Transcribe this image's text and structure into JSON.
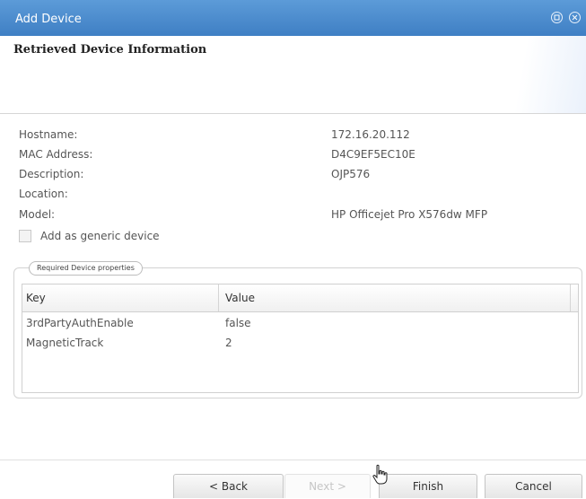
{
  "titlebar": {
    "title": "Add Device"
  },
  "header": {
    "title": "Retrieved Device Information"
  },
  "fields": [
    {
      "label": "Hostname:",
      "value": "172.16.20.112"
    },
    {
      "label": "MAC Address:",
      "value": "D4C9EF5EC10E"
    },
    {
      "label": "Description:",
      "value": "OJP576"
    },
    {
      "label": "Location:",
      "value": ""
    },
    {
      "label": "Model:",
      "value": "HP Officejet Pro X576dw MFP"
    }
  ],
  "generic_device": {
    "label": "Add as generic device",
    "checked": false
  },
  "properties": {
    "legend": "Required Device properties",
    "columns": [
      "Key",
      "Value"
    ],
    "rows": [
      {
        "key": "3rdPartyAuthEnable",
        "value": "false"
      },
      {
        "key": "MagneticTrack",
        "value": "2"
      }
    ]
  },
  "buttons": {
    "back": "< Back",
    "next": "Next >",
    "finish": "Finish",
    "cancel": "Cancel"
  },
  "icons": {
    "restore": "restore-icon",
    "close": "close-icon",
    "cursor": "hand-pointer-icon"
  },
  "colors": {
    "titlebar": "#4a8ace",
    "titlebar_text": "#ffffff"
  }
}
